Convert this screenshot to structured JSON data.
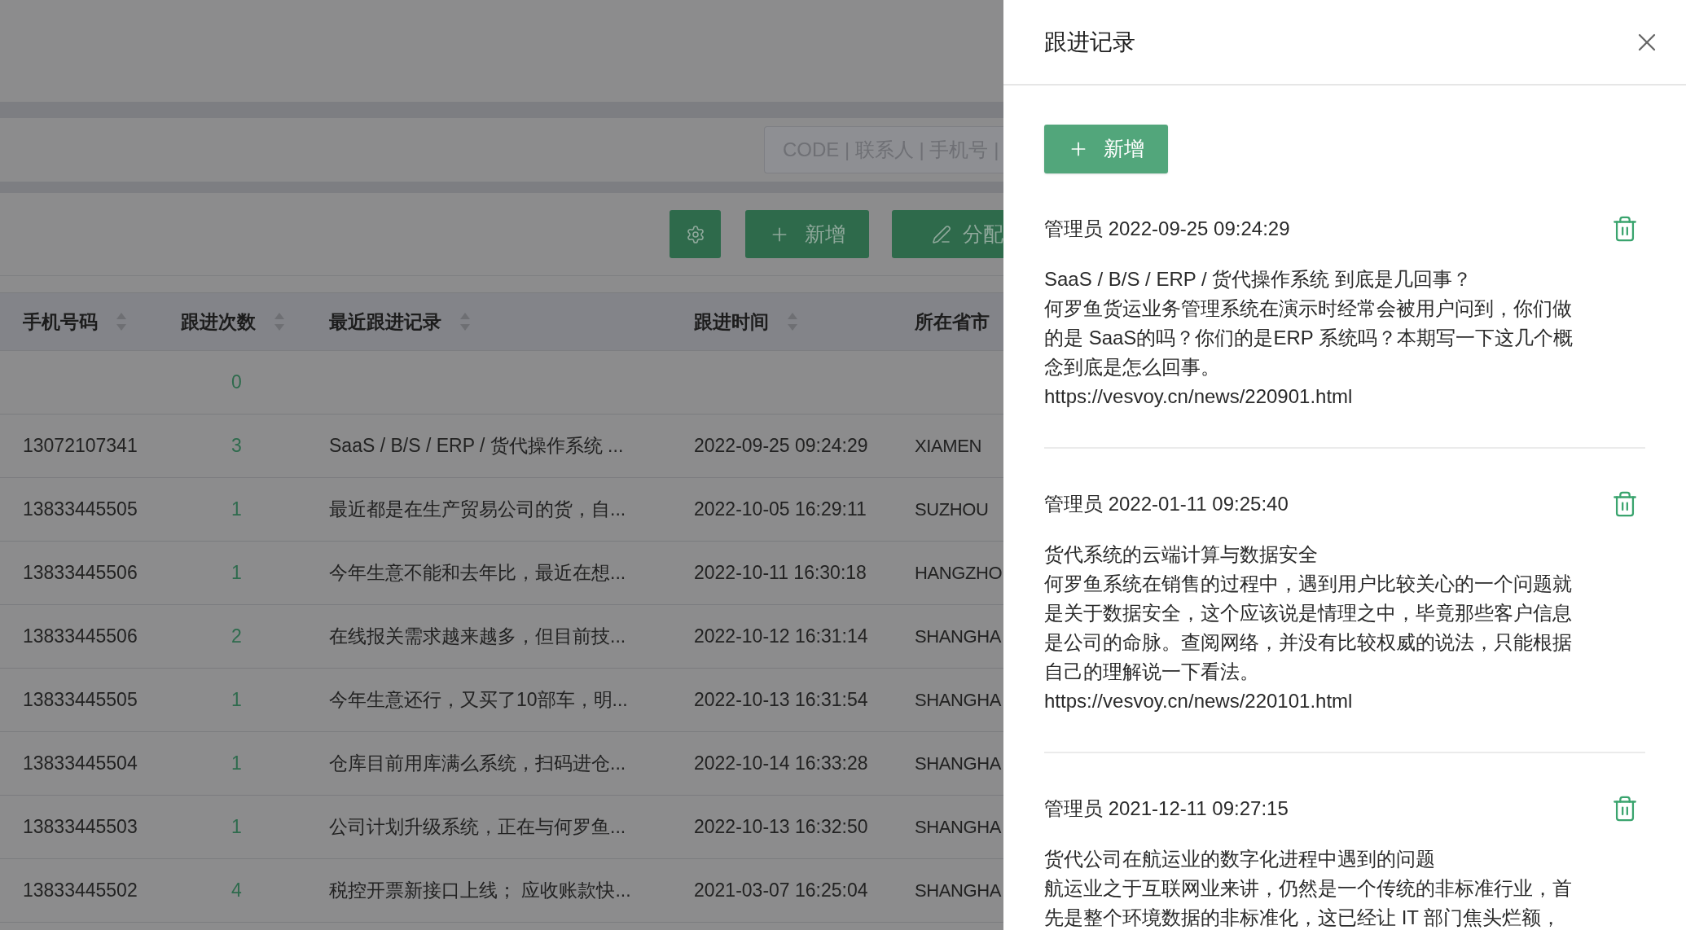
{
  "search": {
    "placeholder": "CODE | 联系人 | 手机号 |"
  },
  "toolbar": [
    {
      "kind": "settings"
    },
    {
      "kind": "add",
      "label": "新增"
    },
    {
      "kind": "edit",
      "label": "分配"
    }
  ],
  "table": {
    "columns": [
      {
        "label": "手机号码",
        "sortable": true
      },
      {
        "label": "跟进次数",
        "sortable": true
      },
      {
        "label": "最近跟进记录",
        "sortable": true
      },
      {
        "label": "跟进时间",
        "sortable": true
      },
      {
        "label": "所在省市",
        "sortable": false
      }
    ],
    "rows": [
      {
        "phone": "",
        "count": "0",
        "record": "",
        "time": "",
        "city": ""
      },
      {
        "phone": "13072107341",
        "count": "3",
        "record": "SaaS / B/S / ERP / 货代操作系统 ...",
        "time": "2022-09-25 09:24:29",
        "city": "XIAMEN"
      },
      {
        "phone": "13833445505",
        "count": "1",
        "record": "最近都是在生产贸易公司的货，自...",
        "time": "2022-10-05 16:29:11",
        "city": "SUZHOU"
      },
      {
        "phone": "13833445506",
        "count": "1",
        "record": "今年生意不能和去年比，最近在想...",
        "time": "2022-10-11 16:30:18",
        "city": "HANGZHO"
      },
      {
        "phone": "13833445506",
        "count": "2",
        "record": "在线报关需求越来越多，但目前技...",
        "time": "2022-10-12 16:31:14",
        "city": "SHANGHA"
      },
      {
        "phone": "13833445505",
        "count": "1",
        "record": "今年生意还行，又买了10部车，明...",
        "time": "2022-10-13 16:31:54",
        "city": "SHANGHA"
      },
      {
        "phone": "13833445504",
        "count": "1",
        "record": "仓库目前用库满么系统，扫码进仓...",
        "time": "2022-10-14 16:33:28",
        "city": "SHANGHA"
      },
      {
        "phone": "13833445503",
        "count": "1",
        "record": "公司计划升级系统，正在与何罗鱼...",
        "time": "2022-10-13 16:32:50",
        "city": "SHANGHA"
      },
      {
        "phone": "13833445502",
        "count": "4",
        "record": "税控开票新接口上线； 应收账款快...",
        "time": "2021-03-07 16:25:04",
        "city": "SHANGHA"
      }
    ]
  },
  "drawer": {
    "title": "跟进记录",
    "add_button": "新增",
    "records": [
      {
        "author": "管理员",
        "time": "2022-09-25 09:24:29",
        "headline": "SaaS / B/S / ERP / 货代操作系统 到底是几回事？",
        "body": "何罗鱼货运业务管理系统在演示时经常会被用户问到，你们做的是 SaaS的吗？你们的是ERP 系统吗？本期写一下这几个概念到底是怎么回事。",
        "link": "https://vesvoy.cn/news/220901.html"
      },
      {
        "author": "管理员",
        "time": "2022-01-11 09:25:40",
        "headline": "货代系统的云端计算与数据安全",
        "body": "何罗鱼系统在销售的过程中，遇到用户比较关心的一个问题就是关于数据安全，这个应该说是情理之中，毕竟那些客户信息是公司的命脉。查阅网络，并没有比较权威的说法，只能根据自己的理解说一下看法。",
        "link": "https://vesvoy.cn/news/220101.html"
      },
      {
        "author": "管理员",
        "time": "2021-12-11 09:27:15",
        "headline": "货代公司在航运业的数字化进程中遇到的问题",
        "body": "航运业之于互联网业来讲，仍然是一个传统的非标准行业，首先是整个环境数据的非标准化，这已经让 IT 部门焦头烂额，"
      }
    ]
  }
}
